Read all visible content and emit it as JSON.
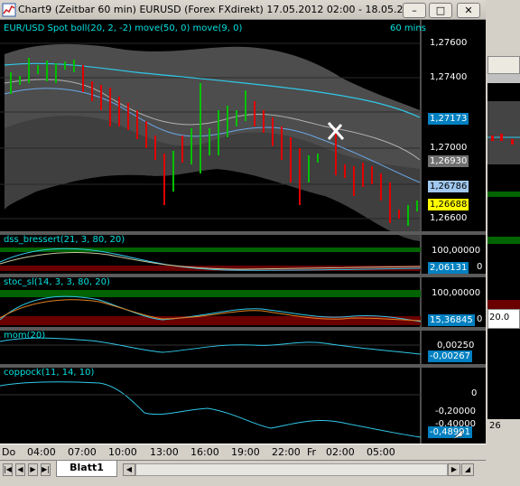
{
  "window": {
    "title": "Chart9 (Zeitbar 60 min)  EURUSD (Forex FXdirekt) 17.05.2012 02:00 - 18.05.201...",
    "min_label": "–",
    "max_label": "□",
    "close_label": "✕"
  },
  "price_panel": {
    "title": "EUR/USD Spot boll(20, 2, -2) move(50, 0) move(9, 0)",
    "interval": "60 mins",
    "axis_ticks": [
      "1,27600",
      "1,27400",
      "1,27200",
      "1,27000",
      "1,26800",
      "1,26600"
    ],
    "box_upper": "1,27173",
    "box_mid": "1,26930",
    "box_lower": "1,26786",
    "box_last": "1,26688"
  },
  "dss_panel": {
    "title": "dss_bressert(21, 3, 80, 20)",
    "tick_top": "100,00000",
    "tick_zero": "0",
    "value_box": "2,06131"
  },
  "stoc_panel": {
    "title": "stoc_sl(14, 3, 3, 80, 20)",
    "tick_top": "100,00000",
    "tick_zero": "0",
    "value_box": "15,36845"
  },
  "mom_panel": {
    "title": "mom(20)",
    "tick_top": "0,00250",
    "value_box": "-0,00267"
  },
  "coppock_panel": {
    "title": "coppock(11, 14, 10)",
    "tick_zero": "0",
    "tick_mid": "-0,20000",
    "tick_low": "-0,40000",
    "value_box": "-0,48991"
  },
  "time_axis": [
    "Do",
    "04:00",
    "07:00",
    "10:00",
    "13:00",
    "16:00",
    "19:00",
    "22:00",
    "Fr",
    "02:00",
    "05:00"
  ],
  "sheet": {
    "tab_label": "Blatt1"
  },
  "behind_window": {
    "labels": [
      "20.0",
      "26"
    ]
  },
  "colors": {
    "up_bar": "#00c000",
    "down_bar": "#e00000",
    "band_fill": "#5a5a5a",
    "ma50": "#30c8e8",
    "ma9": "#b0b0b0",
    "title_text": "#00e0e0"
  }
}
